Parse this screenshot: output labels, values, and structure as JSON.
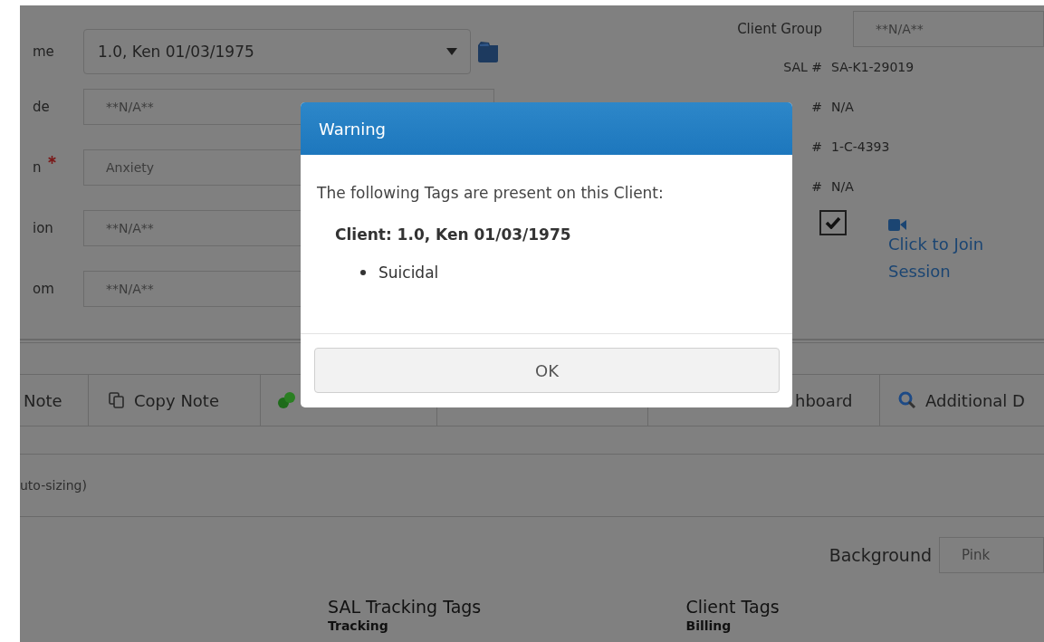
{
  "client_form": {
    "fields": [
      {
        "label": "me",
        "kind": "select",
        "value": "1.0, Ken 01/03/1975",
        "required": false
      },
      {
        "label": "de",
        "kind": "text",
        "value": "**N/A**",
        "required": false
      },
      {
        "label": "n",
        "kind": "text",
        "value": "Anxiety",
        "required": true
      },
      {
        "label": "ion",
        "kind": "text",
        "value": "**N/A**",
        "required": false
      },
      {
        "label": "om",
        "kind": "text",
        "value": "**N/A**",
        "required": false
      }
    ]
  },
  "client_group": {
    "label": "Client Group",
    "value": "**N/A**"
  },
  "id_rows": [
    {
      "label": "SAL #",
      "value": "SA-K1-29019"
    },
    {
      "label": "#",
      "value": "N/A"
    },
    {
      "label": "#",
      "value": "1-C-4393"
    },
    {
      "label": "#",
      "value": "N/A"
    }
  ],
  "telehealth": {
    "checked": true,
    "link": "Click to Join Session"
  },
  "toolbar": {
    "tabs": [
      {
        "kind": "text",
        "label": "Note"
      },
      {
        "kind": "icon_text",
        "label": "Copy Note"
      },
      {
        "kind": "icon"
      },
      {
        "kind": "text",
        "label": "hboard"
      },
      {
        "kind": "icon_text",
        "label": "Additional D"
      }
    ]
  },
  "note_hint": "uto-sizing)",
  "background": {
    "label": "Background",
    "value": "Pink"
  },
  "tag_sections": [
    {
      "title": "SAL Tracking Tags",
      "subtitle": "Tracking"
    },
    {
      "title": "Client Tags",
      "subtitle": "Billing"
    }
  ],
  "dialog": {
    "title": "Warning",
    "message": "The following Tags are present on this Client:",
    "client": "Client: 1.0, Ken 01/03/1975",
    "tags": [
      "Suicidal"
    ],
    "button": "OK"
  }
}
